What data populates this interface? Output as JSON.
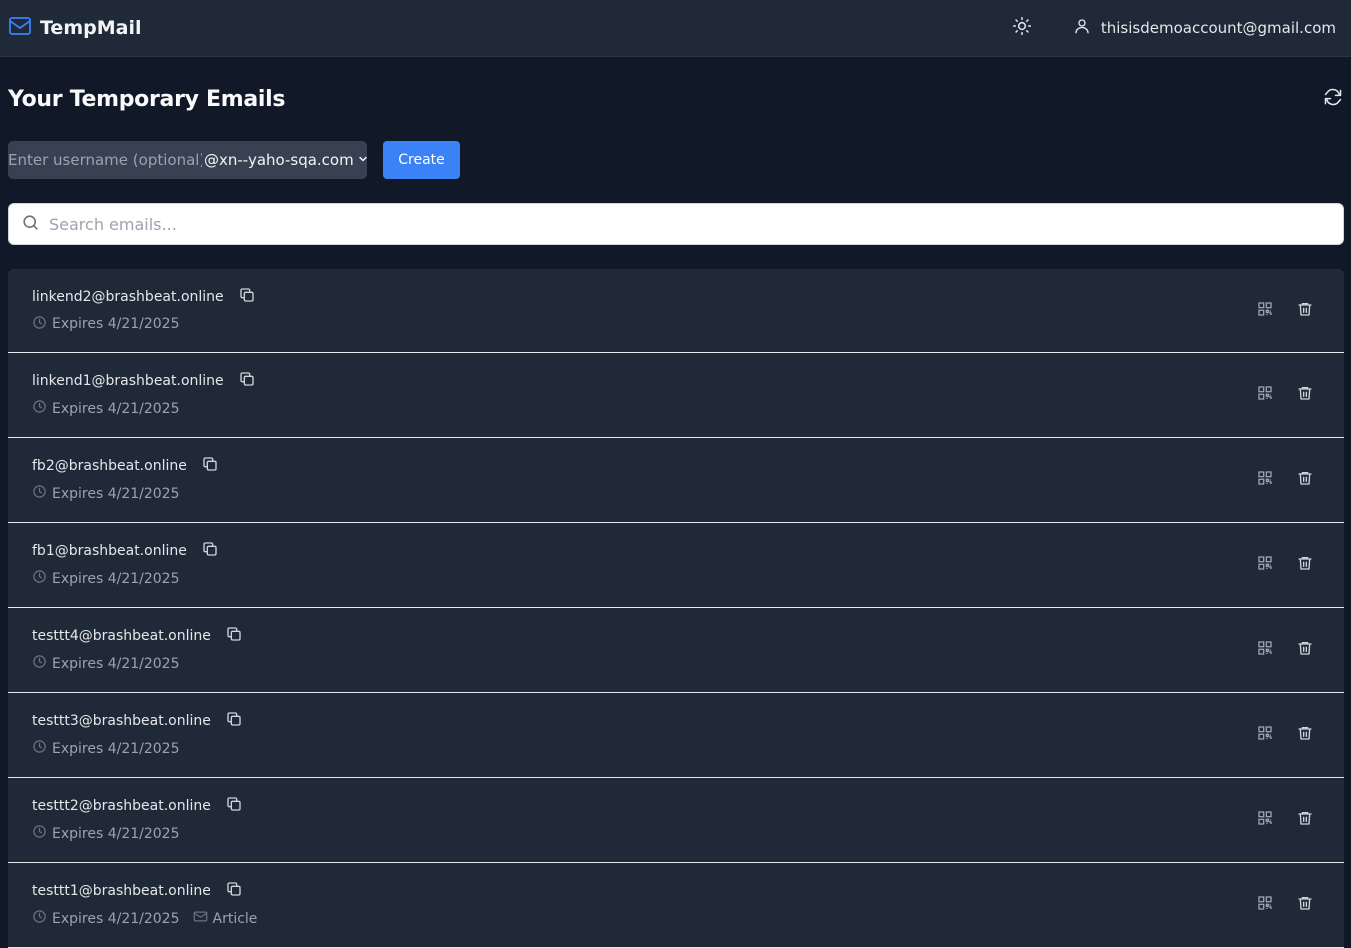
{
  "app": {
    "name": "TempMail",
    "user_email": "thisisdemoaccount@gmail.com"
  },
  "page": {
    "title": "Your Temporary Emails"
  },
  "create": {
    "username_placeholder": "Enter username (optional)",
    "selected_domain": "@xn--yaho-sqa.com",
    "button_label": "Create"
  },
  "search": {
    "placeholder": "Search emails..."
  },
  "emails": [
    {
      "address": "linkend2@brashbeat.online",
      "expires": "Expires 4/21/2025",
      "tag": ""
    },
    {
      "address": "linkend1@brashbeat.online",
      "expires": "Expires 4/21/2025",
      "tag": ""
    },
    {
      "address": "fb2@brashbeat.online",
      "expires": "Expires 4/21/2025",
      "tag": ""
    },
    {
      "address": "fb1@brashbeat.online",
      "expires": "Expires 4/21/2025",
      "tag": ""
    },
    {
      "address": "testtt4@brashbeat.online",
      "expires": "Expires 4/21/2025",
      "tag": ""
    },
    {
      "address": "testtt3@brashbeat.online",
      "expires": "Expires 4/21/2025",
      "tag": ""
    },
    {
      "address": "testtt2@brashbeat.online",
      "expires": "Expires 4/21/2025",
      "tag": ""
    },
    {
      "address": "testtt1@brashbeat.online",
      "expires": "Expires 4/21/2025",
      "tag": "Article"
    }
  ],
  "icons": {
    "brand": "mail-icon",
    "theme": "sun-icon",
    "account": "user-icon",
    "refresh": "refresh-icon",
    "search": "search-icon",
    "copy": "copy-icon",
    "expires": "clock-icon",
    "tag": "mail-icon",
    "qr": "qr-code-icon",
    "delete": "trash-icon"
  },
  "colors": {
    "accent": "#3b82f6",
    "header_bg": "#1f2937",
    "page_bg": "#111827",
    "row_bg": "#1f2937"
  }
}
